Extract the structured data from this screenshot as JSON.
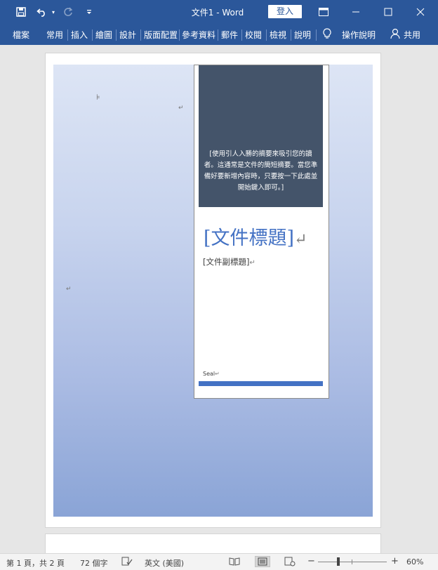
{
  "titlebar": {
    "title": "文件1  -  Word",
    "signin": "登入",
    "icons": [
      "save-icon",
      "undo-icon",
      "redo-icon",
      "customize-qat-icon",
      "ribbon-display-icon",
      "minimize-icon",
      "maximize-icon",
      "close-icon"
    ]
  },
  "ribbon": {
    "tabs": [
      "檔案",
      "常用",
      "插入",
      "繪圖",
      "設計",
      "版面配置",
      "參考資料",
      "郵件",
      "校閱",
      "檢視",
      "說明"
    ],
    "tell_me": "操作說明",
    "share": "共用"
  },
  "document": {
    "abstract": "[使用引人入勝的摘要來吸引您的讀者。這通常是文件的簡短摘要。當您準備好要新增內容時，只要按一下此處並開始鍵入即可。]",
    "title_placeholder": "[文件標題]",
    "subtitle_placeholder": "[文件副標題]",
    "author": "Seal",
    "return_mark": "↵",
    "anchor_mark": "⊧"
  },
  "statusbar": {
    "page_info": "第 1 頁，共 2 頁",
    "word_count": "72 個字",
    "language": "英文 (美國)",
    "zoom_minus": "−",
    "zoom_plus": "+",
    "zoom_level": "60%",
    "zoom_fraction": 0.3
  },
  "colors": {
    "titlebar": "#2b579a",
    "accent": "#4472c4",
    "abstract_bg": "#44546a"
  }
}
